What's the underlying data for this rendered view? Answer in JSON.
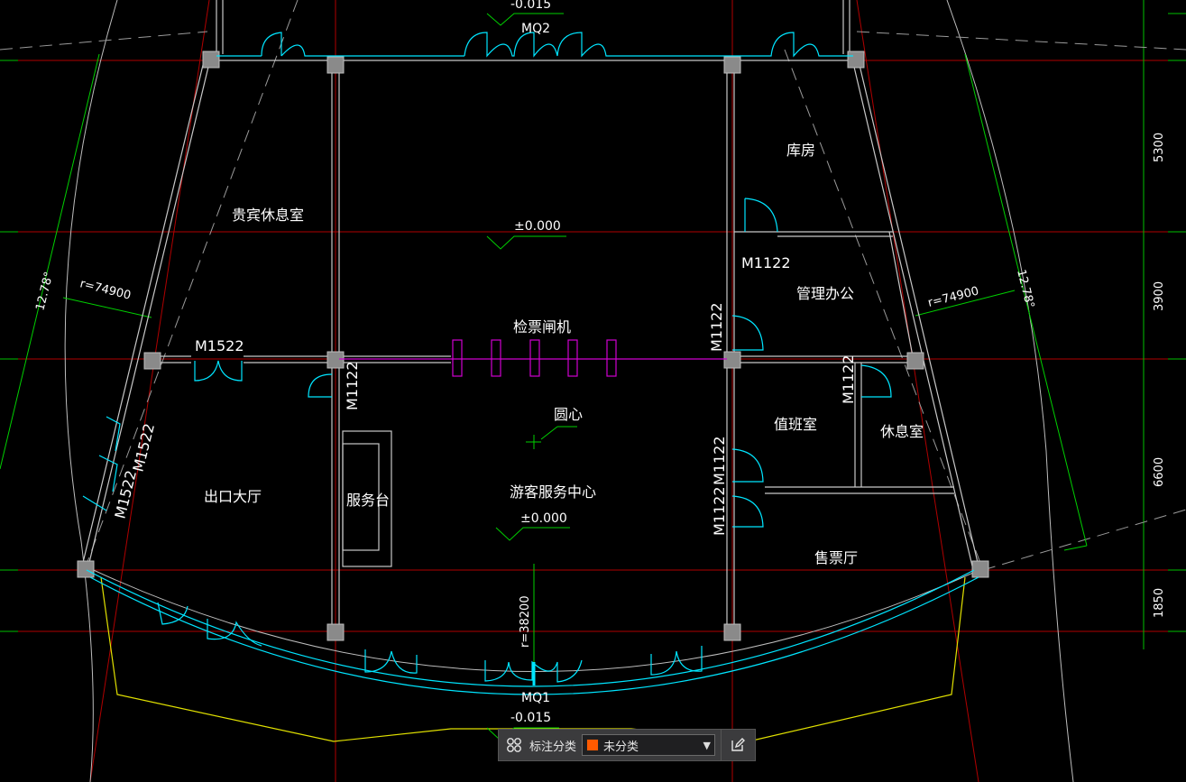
{
  "drawing": {
    "levels": {
      "top": "-0.015",
      "center_upper": "±0.000",
      "center_lower": "±0.000",
      "bottom": "-0.015"
    },
    "rooms": {
      "vip_lounge": "贵宾休息室",
      "storeroom": "库房",
      "management_office": "管理办公",
      "ticket_gates": "检票闸机",
      "exit_hall": "出口大厅",
      "service_desk": "服务台",
      "visitor_center": "游客服务中心",
      "duty_room": "值班室",
      "rest_room": "休息室",
      "ticket_hall": "售票厅"
    },
    "markers": {
      "circle_center": "圆心"
    },
    "doors": {
      "mq2": "MQ2",
      "mq1": "MQ1",
      "m1522_top": "M1522",
      "m1522_wall_a": "M1522",
      "m1522_wall_b": "M1522",
      "m1122_left": "M1122",
      "m1122_office": "M1122",
      "m1122_mgmt": "M1122",
      "m1122_duty": "M1122",
      "m1122_rest": "M1122",
      "m1122_ticket": "M1122"
    },
    "annotations": {
      "radius_left": "r=74900",
      "radius_right": "r=74900",
      "radius_center": "r=38200",
      "angle_left": "12.78°",
      "angle_right": "12.78°"
    },
    "dimensions": [
      "5300",
      "3900",
      "6600",
      "1850"
    ],
    "colors": {
      "background": "#000000",
      "grid": "#c00000",
      "wall": "#c8c8c8",
      "door": "#00e5ff",
      "gate": "#d000d0",
      "dimension": "#00d000",
      "outline": "#e0e000",
      "column": "#9a9a9a"
    }
  },
  "toolbar": {
    "grid_icon": "grid-icon",
    "label": "标注分类",
    "select_value": "未分类",
    "swatch_color": "#ff5a00",
    "dropdown_icon": "caret-down-icon",
    "edit_icon": "edit-icon"
  }
}
